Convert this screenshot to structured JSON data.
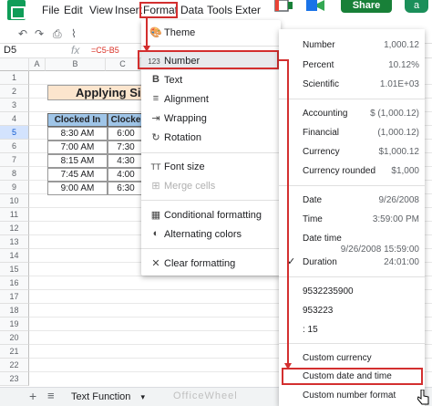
{
  "menubar": {
    "items": [
      "File",
      "Edit",
      "View",
      "Insert",
      "Format",
      "Data",
      "Tools",
      "Exter"
    ],
    "share_label": "Share",
    "avatar_letter": "a"
  },
  "formula_bar": {
    "cell_ref": "D5",
    "fx_symbol": "fx",
    "formula": "=C5-B5"
  },
  "grid": {
    "column_headers": [
      "A",
      "B",
      "C"
    ],
    "row_numbers": [
      "1",
      "2",
      "3",
      "4",
      "5",
      "6",
      "7",
      "8",
      "9",
      "10",
      "11",
      "12",
      "13",
      "14",
      "15",
      "16",
      "17",
      "18",
      "19",
      "20",
      "21",
      "22",
      "23"
    ],
    "selected_row": "5",
    "title": "Applying Sim",
    "table_headers": [
      "Clocked In",
      "Clocke"
    ],
    "rows": [
      [
        "8:30 AM",
        "6:00"
      ],
      [
        "7:00 AM",
        "7:30"
      ],
      [
        "8:15 AM",
        "4:30"
      ],
      [
        "7:45 AM",
        "4:00"
      ],
      [
        "9:00 AM",
        "6:30"
      ]
    ]
  },
  "sheet_bar": {
    "add_label": "+",
    "list_label": "≡",
    "tab_label": "Text Function",
    "tab_arrow": "▾",
    "watermark": "OfficeWheel"
  },
  "format_menu": {
    "items": [
      {
        "icon": "🎨",
        "label": "Theme"
      },
      {
        "icon": "123",
        "label": "Number"
      },
      {
        "icon": "B",
        "label": "Text"
      },
      {
        "icon": "≡",
        "label": "Alignment"
      },
      {
        "icon": "⇥",
        "label": "Wrapping"
      },
      {
        "icon": "↻",
        "label": "Rotation"
      },
      {
        "icon": "TT",
        "label": "Font size"
      },
      {
        "icon": "⊞",
        "label": "Merge cells"
      },
      {
        "icon": "▦",
        "label": "Conditional formatting"
      },
      {
        "icon": "◐",
        "label": "Alternating colors"
      },
      {
        "icon": "✕",
        "label": "Clear formatting"
      }
    ]
  },
  "number_menu": {
    "items": [
      {
        "label": "Number",
        "value": "1,000.12"
      },
      {
        "label": "Percent",
        "value": "10.12%"
      },
      {
        "label": "Scientific",
        "value": "1.01E+03"
      },
      {
        "label": "Accounting",
        "value": "$ (1,000.12)"
      },
      {
        "label": "Financial",
        "value": "(1,000.12)"
      },
      {
        "label": "Currency",
        "value": "$1,000.12"
      },
      {
        "label": "Currency rounded",
        "value": "$1,000"
      },
      {
        "label": "Date",
        "value": "9/26/2008"
      },
      {
        "label": "Time",
        "value": "3:59:00 PM"
      },
      {
        "label": "Date time",
        "value": "9/26/2008 15:59:00"
      },
      {
        "label": "Duration",
        "value": "24:01:00"
      },
      {
        "label": "9532235900",
        "value": ""
      },
      {
        "label": "953223",
        "value": ""
      },
      {
        "label": ": 15",
        "value": ""
      },
      {
        "label": "Custom currency",
        "value": ""
      },
      {
        "label": "Custom date and time",
        "value": ""
      },
      {
        "label": "Custom number format",
        "value": ""
      }
    ],
    "check_mark": "✓"
  },
  "colors": {
    "highlight_red": "#d32f2f",
    "header_blue": "#9fc5e8",
    "title_peach": "#fce5cd",
    "share_green": "#188038"
  }
}
